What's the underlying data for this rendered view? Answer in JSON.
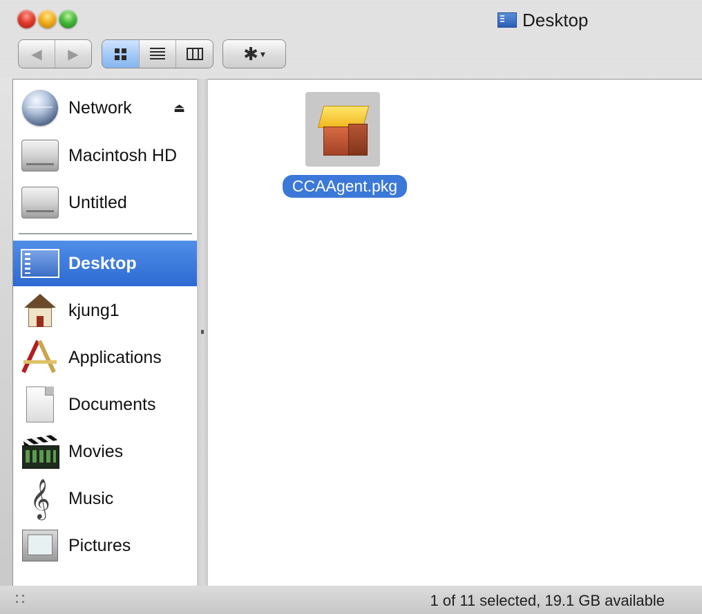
{
  "window": {
    "title": "Desktop",
    "title_icon": "desktop-folder-icon"
  },
  "toolbar": {
    "back_icon": "◀",
    "forward_icon": "▶",
    "views": [
      "icon-view",
      "list-view",
      "column-view"
    ],
    "active_view": "icon-view",
    "action_icon": "gear-icon"
  },
  "sidebar": {
    "devices": [
      {
        "label": "Network",
        "icon": "network-globe-icon",
        "eject": true
      },
      {
        "label": "Macintosh HD",
        "icon": "hard-drive-icon"
      },
      {
        "label": "Untitled",
        "icon": "hard-drive-icon"
      }
    ],
    "places": [
      {
        "label": "Desktop",
        "icon": "desktop-icon",
        "selected": true
      },
      {
        "label": "kjung1",
        "icon": "home-icon"
      },
      {
        "label": "Applications",
        "icon": "applications-icon"
      },
      {
        "label": "Documents",
        "icon": "documents-icon"
      },
      {
        "label": "Movies",
        "icon": "movies-icon"
      },
      {
        "label": "Music",
        "icon": "music-icon"
      },
      {
        "label": "Pictures",
        "icon": "pictures-icon"
      }
    ]
  },
  "content": {
    "files": [
      {
        "name": "CCAAgent.pkg",
        "icon": "package-icon",
        "selected": true
      }
    ]
  },
  "status": {
    "text": "1 of 11 selected, 19.1 GB available"
  },
  "colors": {
    "selection": "#3b78d8",
    "sidebar_selected": "#2d6ad2"
  }
}
